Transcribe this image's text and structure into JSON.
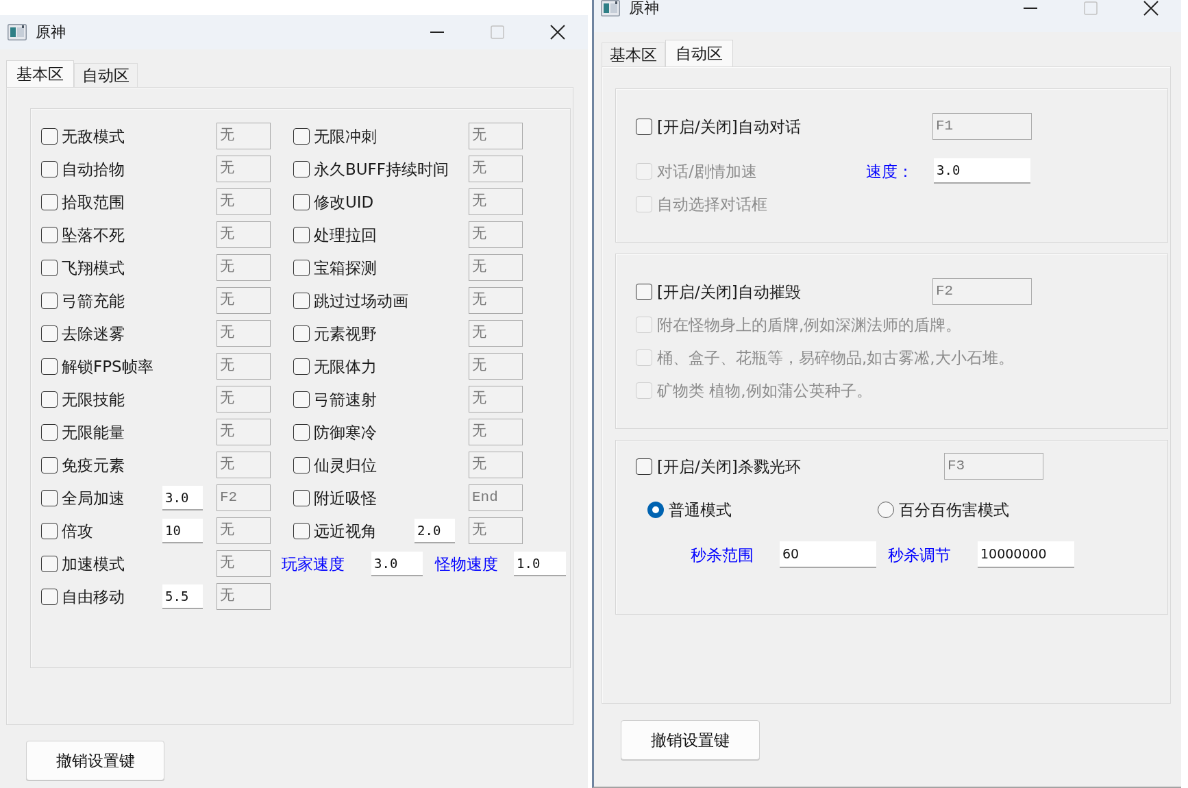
{
  "left_window": {
    "title": "原神",
    "tabs": [
      {
        "label": "基本区",
        "selected": true
      },
      {
        "label": "自动区",
        "selected": false
      }
    ],
    "left_column": [
      {
        "label": "无敌模式",
        "checked": false,
        "hotkey": "无"
      },
      {
        "label": "自动拾物",
        "checked": false,
        "hotkey": "无"
      },
      {
        "label": "拾取范围",
        "checked": false,
        "hotkey": "无"
      },
      {
        "label": "坠落不死",
        "checked": false,
        "hotkey": "无"
      },
      {
        "label": "飞翔模式",
        "checked": false,
        "hotkey": "无"
      },
      {
        "label": "弓箭充能",
        "checked": false,
        "hotkey": "无"
      },
      {
        "label": "去除迷雾",
        "checked": false,
        "hotkey": "无"
      },
      {
        "label": "解锁FPS帧率",
        "checked": false,
        "hotkey": "无"
      },
      {
        "label": "无限技能",
        "checked": false,
        "hotkey": "无"
      },
      {
        "label": "无限能量",
        "checked": false,
        "hotkey": "无"
      },
      {
        "label": "免疫元素",
        "checked": false,
        "hotkey": "无"
      },
      {
        "label": "全局加速",
        "checked": false,
        "value": "3.0",
        "hotkey": "F2"
      },
      {
        "label": "倍攻",
        "checked": false,
        "value": "10",
        "hotkey": "无"
      },
      {
        "label": "加速模式",
        "checked": false,
        "hotkey": "无"
      },
      {
        "label": "自由移动",
        "checked": false,
        "value": "5.5",
        "hotkey": "无"
      }
    ],
    "right_column": [
      {
        "kind": "toggle",
        "label": "无限冲刺",
        "checked": false,
        "hotkey": "无"
      },
      {
        "kind": "toggle",
        "label": "永久BUFF持续时间",
        "checked": false,
        "hotkey": "无"
      },
      {
        "kind": "toggle",
        "label": "修改UID",
        "checked": false,
        "hotkey": "无"
      },
      {
        "kind": "toggle",
        "label": "处理拉回",
        "checked": false,
        "hotkey": "无"
      },
      {
        "kind": "toggle",
        "label": "宝箱探测",
        "checked": false,
        "hotkey": "无"
      },
      {
        "kind": "toggle",
        "label": "跳过过场动画",
        "checked": false,
        "hotkey": "无"
      },
      {
        "kind": "toggle",
        "label": "元素视野",
        "checked": false,
        "hotkey": "无"
      },
      {
        "kind": "toggle",
        "label": "无限体力",
        "checked": false,
        "hotkey": "无"
      },
      {
        "kind": "toggle",
        "label": "弓箭速射",
        "checked": false,
        "hotkey": "无"
      },
      {
        "kind": "toggle",
        "label": "防御寒冷",
        "checked": false,
        "hotkey": "无"
      },
      {
        "kind": "toggle",
        "label": "仙灵归位",
        "checked": false,
        "hotkey": "无"
      },
      {
        "kind": "toggle",
        "label": "附近吸怪",
        "checked": false,
        "hotkey": "End"
      },
      {
        "kind": "toggle",
        "label": "远近视角",
        "checked": false,
        "value": "2.0",
        "hotkey": "无"
      },
      {
        "kind": "speeds",
        "fields": [
          {
            "label": "玩家速度",
            "value": "3.0"
          },
          {
            "label": "怪物速度",
            "value": "1.0"
          }
        ]
      }
    ],
    "button": "撤销设置键"
  },
  "right_window": {
    "title": "原神",
    "tabs": [
      {
        "label": "基本区",
        "selected": false
      },
      {
        "label": "自动区",
        "selected": true
      }
    ],
    "groups": [
      {
        "toggle": {
          "label": "[开启/关闭]自动对话",
          "checked": false
        },
        "hotkey": "F1",
        "options": [
          {
            "label": "对话/剧情加速",
            "checked": false,
            "disabled": true,
            "speed": {
              "label": "速度：",
              "value": "3.0"
            }
          },
          {
            "label": "自动选择对话框",
            "checked": false,
            "disabled": true
          }
        ]
      },
      {
        "toggle": {
          "label": "[开启/关闭]自动摧毁",
          "checked": false
        },
        "hotkey": "F2",
        "options": [
          {
            "label": "附在怪物身上的盾牌,例如深渊法师的盾牌。",
            "checked": false,
            "disabled": true
          },
          {
            "label": "桶、盒子、花瓶等，易碎物品,如古雾凇,大小石堆。",
            "checked": false,
            "disabled": true
          },
          {
            "label": "矿物类 植物,例如蒲公英种子。",
            "checked": false,
            "disabled": true
          }
        ]
      },
      {
        "toggle": {
          "label": "[开启/关闭]杀戮光环",
          "checked": false
        },
        "hotkey": "F3",
        "modes": [
          {
            "label": "普通模式",
            "selected": true
          },
          {
            "label": "百分百伤害模式",
            "selected": false
          }
        ],
        "inputs": [
          {
            "label": "秒杀范围",
            "value": "60"
          },
          {
            "label": "秒杀调节",
            "value": "10000000"
          }
        ]
      }
    ],
    "button": "撤销设置键"
  }
}
